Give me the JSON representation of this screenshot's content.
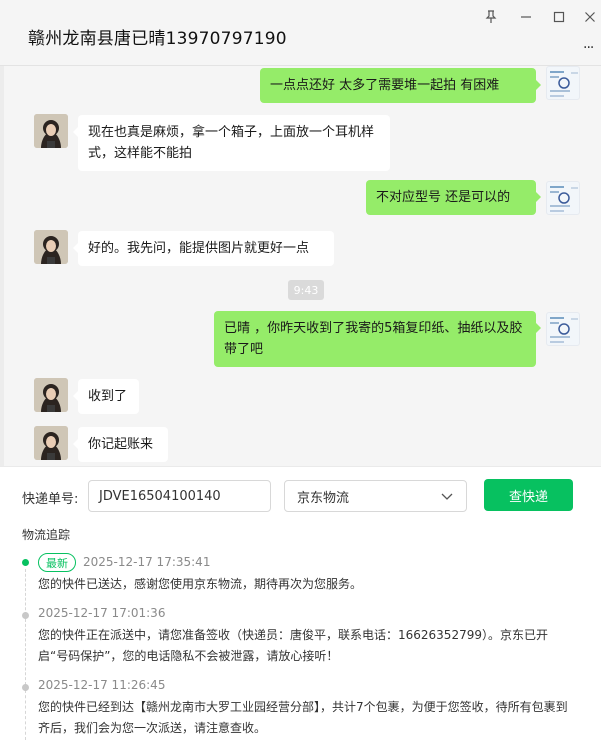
{
  "window": {
    "title": "赣州龙南县唐已晴13970797190",
    "pin_icon": "pin-icon",
    "minimize_icon": "minimize-icon",
    "maximize_icon": "maximize-icon",
    "close_icon": "close-icon",
    "more_label": "..."
  },
  "chat": {
    "messages": [
      {
        "side": "me",
        "text": "一点点还好  太多了需要堆一起拍  有困难"
      },
      {
        "side": "them",
        "text": "现在也真是麻烦，拿一个箱子，上面放一个耳机样式，这样能不能拍"
      },
      {
        "side": "me",
        "text": "不对应型号  还是可以的"
      },
      {
        "side": "them",
        "text": "好的。我先问，能提供图片就更好一点"
      },
      {
        "side": "time",
        "text": "9:43"
      },
      {
        "side": "me",
        "text": "已晴  ，你昨天收到了我寄的5箱复印纸、抽纸以及胶带了吧"
      },
      {
        "side": "them",
        "text": "收到了"
      },
      {
        "side": "them",
        "text": "你记起账来"
      }
    ]
  },
  "tracking": {
    "label": "快递单号:",
    "number": "JDVE16504100140",
    "carrier": "京东物流",
    "button": "查快递",
    "section_title": "物流追踪",
    "colors": {
      "accent": "#07c160",
      "bubble_me": "#95ec69"
    },
    "events": [
      {
        "badge": "最新",
        "time": "2025-12-17 17:35:41",
        "text": "您的快件已送达，感谢您使用京东物流，期待再次为您服务。"
      },
      {
        "badge": "",
        "time": "2025-12-17 17:01:36",
        "text": "您的快件正在派送中，请您准备签收（快递员：唐俊平，联系电话：16626352799）。京东已开启“号码保护”，您的电话隐私不会被泄露，请放心接听！"
      },
      {
        "badge": "",
        "time": "2025-12-17 11:26:45",
        "text": "您的快件已经到达【赣州龙南市大罗工业园经营分部】，共计7个包裹，为便于您签收，待所有包裹到齐后，我们会为您一次派送，请注意查收。"
      }
    ]
  }
}
